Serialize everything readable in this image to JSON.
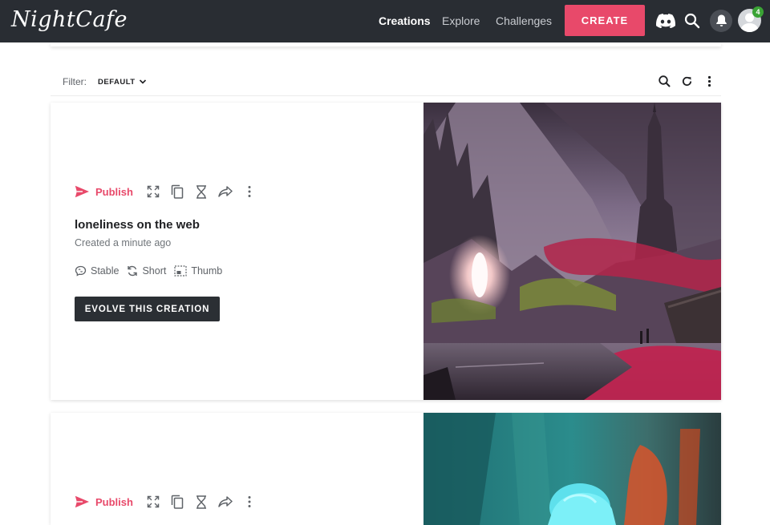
{
  "app": {
    "logo": "NightCafe",
    "nav": [
      {
        "label": "Creations",
        "active": true
      },
      {
        "label": "Explore",
        "active": false
      },
      {
        "label": "Challenges",
        "active": false
      }
    ],
    "create_label": "CREATE",
    "notification_count": "4"
  },
  "filter": {
    "label": "Filter:",
    "value": "DEFAULT"
  },
  "cards": [
    {
      "publish_label": "Publish",
      "title": "loneliness on the web",
      "created": "Created a minute ago",
      "meta": [
        "Stable",
        "Short",
        "Thumb"
      ],
      "evolve_label": "EVOLVE THIS CREATION"
    },
    {
      "publish_label": "Publish"
    }
  ],
  "colors": {
    "nav_bg": "#292d33",
    "accent": "#e8496a",
    "dark_button": "#2b2f34"
  }
}
